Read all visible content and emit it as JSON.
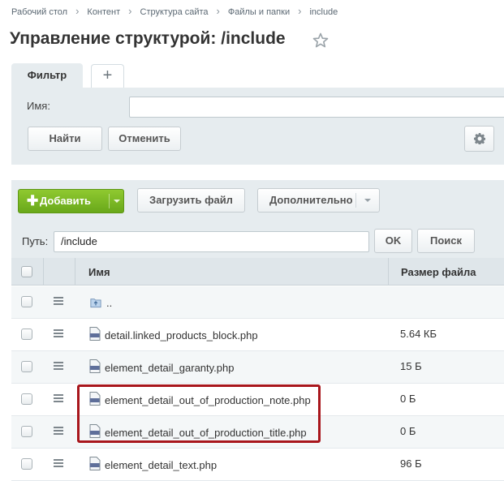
{
  "breadcrumb": [
    "Рабочий стол",
    "Контент",
    "Структура сайта",
    "Файлы и папки",
    "include"
  ],
  "page_title": "Управление структурой: /include",
  "filter": {
    "tab_label": "Фильтр",
    "add_tab": "+",
    "name_label": "Имя:",
    "name_value": "",
    "find_label": "Найти",
    "cancel_label": "Отменить"
  },
  "toolbar": {
    "add_label": "Добавить",
    "upload_label": "Загрузить файл",
    "more_label": "Дополнительно",
    "path_label": "Путь:",
    "path_value": "/include",
    "ok_label": "OK",
    "search_label": "Поиск"
  },
  "table": {
    "headers": {
      "name": "Имя",
      "size": "Размер файла"
    },
    "rows": [
      {
        "name": "..",
        "size": "",
        "type": "folder-up"
      },
      {
        "name": "detail.linked_products_block.php",
        "size": "5.64 КБ",
        "type": "php"
      },
      {
        "name": "element_detail_garanty.php",
        "size": "15 Б",
        "type": "php"
      },
      {
        "name": "element_detail_out_of_production_note.php",
        "size": "0 Б",
        "type": "php"
      },
      {
        "name": "element_detail_out_of_production_title.php",
        "size": "0 Б",
        "type": "php"
      },
      {
        "name": "element_detail_text.php",
        "size": "96 Б",
        "type": "php"
      }
    ]
  },
  "colors": {
    "accent_green": "#6fae1e",
    "highlight_red": "#a8161c",
    "panel_bg": "#e6ecef"
  }
}
